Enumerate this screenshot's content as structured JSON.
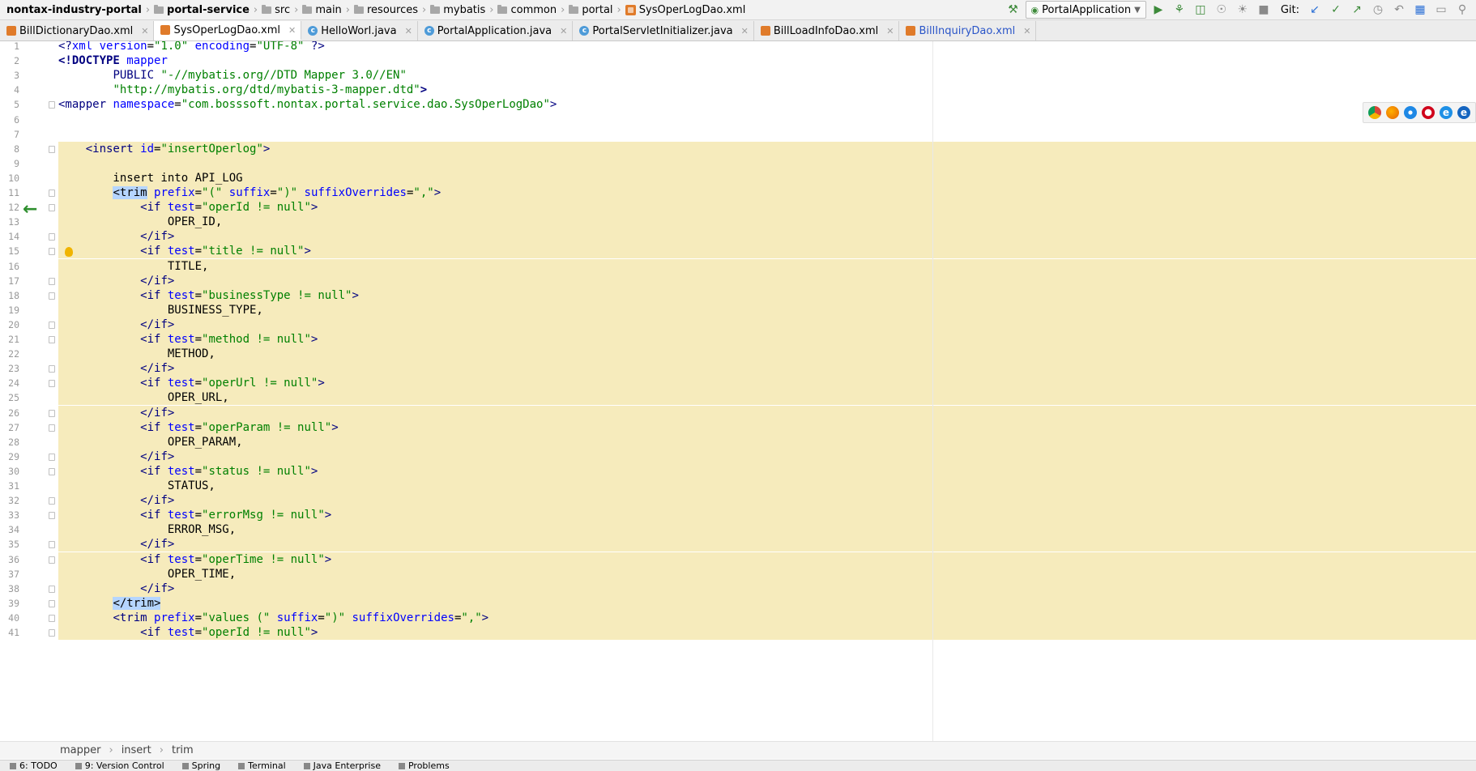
{
  "navbar": {
    "crumbs": [
      {
        "label": "nontax-industry-portal",
        "bold": true
      },
      {
        "label": "portal-service",
        "bold": true
      },
      {
        "label": "src"
      },
      {
        "label": "main"
      },
      {
        "label": "resources"
      },
      {
        "label": "mybatis"
      },
      {
        "label": "common"
      },
      {
        "label": "portal"
      },
      {
        "label": "SysOperLogDao.xml"
      }
    ],
    "run_config": "PortalApplication",
    "git_label": "Git:"
  },
  "tabs": [
    {
      "label": "BillDictionaryDao.xml",
      "type": "xml",
      "active": false
    },
    {
      "label": "SysOperLogDao.xml",
      "type": "xml",
      "active": true
    },
    {
      "label": "HelloWorl.java",
      "type": "java",
      "active": false
    },
    {
      "label": "PortalApplication.java",
      "type": "java",
      "active": false
    },
    {
      "label": "PortalServletInitializer.java",
      "type": "java",
      "active": false
    },
    {
      "label": "BillLoadInfoDao.xml",
      "type": "xml",
      "active": false
    },
    {
      "label": "BillInquiryDao.xml",
      "type": "xml",
      "active": false,
      "blue": true
    }
  ],
  "code": {
    "lines": [
      {
        "n": "1",
        "segs": [
          [
            "tagc",
            "<?"
          ],
          [
            "attr",
            "xml version"
          ],
          [
            "pl",
            "="
          ],
          [
            "val",
            "\"1.0\""
          ],
          [
            "attr",
            " encoding"
          ],
          [
            "pl",
            "="
          ],
          [
            "val",
            "\"UTF-8\""
          ],
          [
            "tagc",
            " ?>"
          ]
        ]
      },
      {
        "n": "2",
        "segs": [
          [
            "bang",
            "<!DOCTYPE "
          ],
          [
            "attr",
            "mapper"
          ]
        ]
      },
      {
        "n": "3",
        "segs": [
          [
            "pl",
            "        "
          ],
          [
            "tagc",
            "PUBLIC "
          ],
          [
            "val",
            "\"-//mybatis.org//DTD Mapper 3.0//EN\""
          ]
        ]
      },
      {
        "n": "4",
        "segs": [
          [
            "pl",
            "        "
          ],
          [
            "val",
            "\"http://mybatis.org/dtd/mybatis-3-mapper.dtd\""
          ],
          [
            "bang",
            ">"
          ]
        ]
      },
      {
        "n": "5",
        "segs": [
          [
            "tagc",
            "<mapper "
          ],
          [
            "attr",
            "namespace"
          ],
          [
            "pl",
            "="
          ],
          [
            "val",
            "\"com.bosssoft.nontax.portal.service.dao.SysOperLogDao\""
          ],
          [
            "tagc",
            ">"
          ]
        ]
      },
      {
        "n": "6",
        "segs": []
      },
      {
        "n": "7",
        "segs": []
      },
      {
        "n": "8",
        "segs": [
          [
            "pl",
            "    "
          ],
          [
            "tagc",
            "<insert "
          ],
          [
            "attr",
            "id"
          ],
          [
            "pl",
            "="
          ],
          [
            "val",
            "\"insertOperlog\""
          ],
          [
            "tagc",
            ">"
          ]
        ],
        "hl": true
      },
      {
        "n": "9",
        "segs": [],
        "hl": true
      },
      {
        "n": "10",
        "segs": [
          [
            "pl",
            "        insert into API_LOG"
          ]
        ],
        "hl": true
      },
      {
        "n": "11",
        "segs": [
          [
            "pl",
            "        "
          ],
          [
            "sel",
            "<trim"
          ],
          [
            "attr",
            " prefix"
          ],
          [
            "pl",
            "="
          ],
          [
            "val",
            "\"(\""
          ],
          [
            "attr",
            " suffix"
          ],
          [
            "pl",
            "="
          ],
          [
            "val",
            "\")\""
          ],
          [
            "attr",
            " suffixOverrides"
          ],
          [
            "pl",
            "="
          ],
          [
            "val",
            "\",\""
          ],
          [
            "tagc",
            ">"
          ]
        ],
        "hl": true
      },
      {
        "n": "12",
        "segs": [
          [
            "pl",
            "            "
          ],
          [
            "tagc",
            "<if "
          ],
          [
            "attr",
            "test"
          ],
          [
            "pl",
            "="
          ],
          [
            "val",
            "\"operId != null\""
          ],
          [
            "tagc",
            ">"
          ]
        ],
        "hl": true
      },
      {
        "n": "13",
        "segs": [
          [
            "pl",
            "                OPER_ID,"
          ]
        ],
        "hl": true
      },
      {
        "n": "14",
        "segs": [
          [
            "pl",
            "            "
          ],
          [
            "tagc",
            "</if>"
          ]
        ],
        "hl": true
      },
      {
        "n": "15",
        "segs": [
          [
            "pl",
            "            "
          ],
          [
            "tagc",
            "<if "
          ],
          [
            "attr",
            "test"
          ],
          [
            "pl",
            "="
          ],
          [
            "val",
            "\"title != null\""
          ],
          [
            "tagc",
            ">"
          ]
        ],
        "hl": true
      },
      {
        "n": "16",
        "segs": [
          [
            "pl",
            "                TITLE,"
          ]
        ],
        "hl": true
      },
      {
        "n": "17",
        "segs": [
          [
            "pl",
            "            "
          ],
          [
            "tagc",
            "</if>"
          ]
        ],
        "hl": true
      },
      {
        "n": "18",
        "segs": [
          [
            "pl",
            "            "
          ],
          [
            "tagc",
            "<if "
          ],
          [
            "attr",
            "test"
          ],
          [
            "pl",
            "="
          ],
          [
            "val",
            "\"businessType != null\""
          ],
          [
            "tagc",
            ">"
          ]
        ],
        "hl": true
      },
      {
        "n": "19",
        "segs": [
          [
            "pl",
            "                BUSINESS_TYPE,"
          ]
        ],
        "hl": true
      },
      {
        "n": "20",
        "segs": [
          [
            "pl",
            "            "
          ],
          [
            "tagc",
            "</if>"
          ]
        ],
        "hl": true
      },
      {
        "n": "21",
        "segs": [
          [
            "pl",
            "            "
          ],
          [
            "tagc",
            "<if "
          ],
          [
            "attr",
            "test"
          ],
          [
            "pl",
            "="
          ],
          [
            "val",
            "\"method != null\""
          ],
          [
            "tagc",
            ">"
          ]
        ],
        "hl": true
      },
      {
        "n": "22",
        "segs": [
          [
            "pl",
            "                METHOD,"
          ]
        ],
        "hl": true
      },
      {
        "n": "23",
        "segs": [
          [
            "pl",
            "            "
          ],
          [
            "tagc",
            "</if>"
          ]
        ],
        "hl": true
      },
      {
        "n": "24",
        "segs": [
          [
            "pl",
            "            "
          ],
          [
            "tagc",
            "<if "
          ],
          [
            "attr",
            "test"
          ],
          [
            "pl",
            "="
          ],
          [
            "val",
            "\"operUrl != null\""
          ],
          [
            "tagc",
            ">"
          ]
        ],
        "hl": true
      },
      {
        "n": "25",
        "segs": [
          [
            "pl",
            "                OPER_URL,"
          ]
        ],
        "hl": true
      },
      {
        "n": "26",
        "segs": [
          [
            "pl",
            "            "
          ],
          [
            "tagc",
            "</if>"
          ]
        ],
        "hl": true
      },
      {
        "n": "27",
        "segs": [
          [
            "pl",
            "            "
          ],
          [
            "tagc",
            "<if "
          ],
          [
            "attr",
            "test"
          ],
          [
            "pl",
            "="
          ],
          [
            "val",
            "\"operParam != null\""
          ],
          [
            "tagc",
            ">"
          ]
        ],
        "hl": true
      },
      {
        "n": "28",
        "segs": [
          [
            "pl",
            "                OPER_PARAM,"
          ]
        ],
        "hl": true
      },
      {
        "n": "29",
        "segs": [
          [
            "pl",
            "            "
          ],
          [
            "tagc",
            "</if>"
          ]
        ],
        "hl": true
      },
      {
        "n": "30",
        "segs": [
          [
            "pl",
            "            "
          ],
          [
            "tagc",
            "<if "
          ],
          [
            "attr",
            "test"
          ],
          [
            "pl",
            "="
          ],
          [
            "val",
            "\"status != null\""
          ],
          [
            "tagc",
            ">"
          ]
        ],
        "hl": true
      },
      {
        "n": "31",
        "segs": [
          [
            "pl",
            "                STATUS,"
          ]
        ],
        "hl": true
      },
      {
        "n": "32",
        "segs": [
          [
            "pl",
            "            "
          ],
          [
            "tagc",
            "</if>"
          ]
        ],
        "hl": true
      },
      {
        "n": "33",
        "segs": [
          [
            "pl",
            "            "
          ],
          [
            "tagc",
            "<if "
          ],
          [
            "attr",
            "test"
          ],
          [
            "pl",
            "="
          ],
          [
            "val",
            "\"errorMsg != null\""
          ],
          [
            "tagc",
            ">"
          ]
        ],
        "hl": true
      },
      {
        "n": "34",
        "segs": [
          [
            "pl",
            "                ERROR_MSG,"
          ]
        ],
        "hl": true
      },
      {
        "n": "35",
        "segs": [
          [
            "pl",
            "            "
          ],
          [
            "tagc",
            "</if>"
          ]
        ],
        "hl": true
      },
      {
        "n": "36",
        "segs": [
          [
            "pl",
            "            "
          ],
          [
            "tagc",
            "<if "
          ],
          [
            "attr",
            "test"
          ],
          [
            "pl",
            "="
          ],
          [
            "val",
            "\"operTime != null\""
          ],
          [
            "tagc",
            ">"
          ]
        ],
        "hl": true
      },
      {
        "n": "37",
        "segs": [
          [
            "pl",
            "                OPER_TIME,"
          ]
        ],
        "hl": true
      },
      {
        "n": "38",
        "segs": [
          [
            "pl",
            "            "
          ],
          [
            "tagc",
            "</if>"
          ]
        ],
        "hl": true
      },
      {
        "n": "39",
        "segs": [
          [
            "pl",
            "        "
          ],
          [
            "sel",
            "</trim>"
          ]
        ],
        "hl": true
      },
      {
        "n": "40",
        "segs": [
          [
            "pl",
            "        "
          ],
          [
            "tagc",
            "<trim "
          ],
          [
            "attr",
            "prefix"
          ],
          [
            "pl",
            "="
          ],
          [
            "val",
            "\"values (\""
          ],
          [
            "attr",
            " suffix"
          ],
          [
            "pl",
            "="
          ],
          [
            "val",
            "\")\""
          ],
          [
            "attr",
            " suffixOverrides"
          ],
          [
            "pl",
            "="
          ],
          [
            "val",
            "\",\""
          ],
          [
            "tagc",
            ">"
          ]
        ],
        "hl": true
      },
      {
        "n": "41",
        "segs": [
          [
            "pl",
            "            "
          ],
          [
            "tagc",
            "<if "
          ],
          [
            "attr",
            "test"
          ],
          [
            "pl",
            "="
          ],
          [
            "val",
            "\"operId != null\""
          ],
          [
            "tagc",
            ">"
          ]
        ],
        "hl": true
      }
    ]
  },
  "bottom_crumbs": [
    "mapper",
    "insert",
    "trim"
  ],
  "statusbar": [
    "6: TODO",
    "9: Version Control",
    "Spring",
    "Terminal",
    "Java Enterprise",
    "Problems"
  ],
  "colors": {
    "highlight_bg": "#f6ebbc",
    "tag": "#000080",
    "attr": "#0000ff",
    "string": "#008000",
    "selection": "#b5d5ff"
  }
}
